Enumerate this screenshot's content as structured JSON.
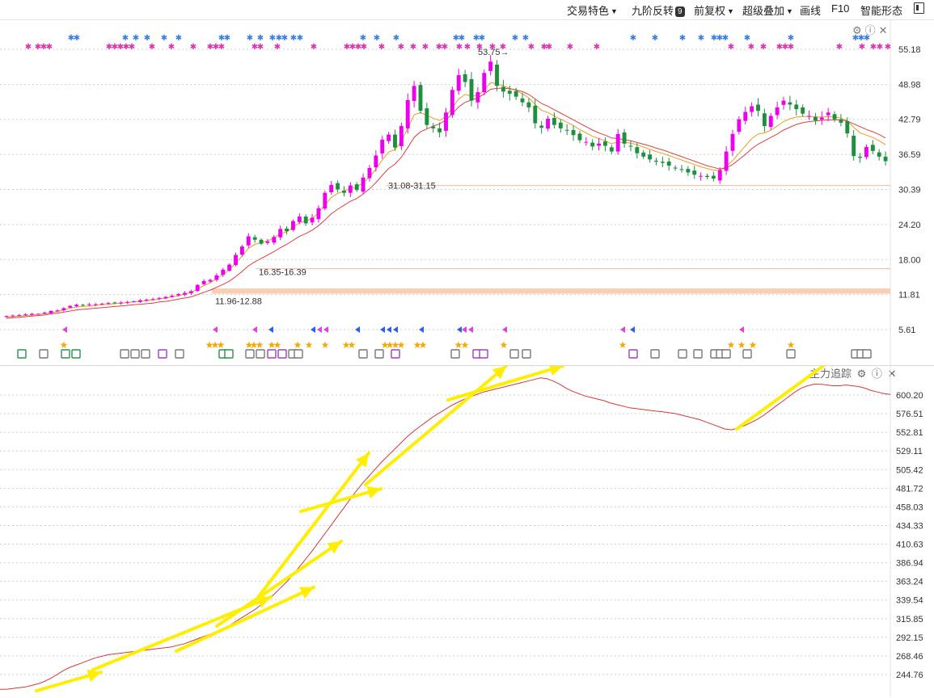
{
  "toolbar": {
    "trade_feature": "交易特色",
    "nine_reversal": "九阶反转",
    "nine_badge": "9",
    "adjust": "前复权",
    "overlay": "超级叠加",
    "draw": "画线",
    "f10": "F10",
    "smart_pattern": "智能形态"
  },
  "sub_panel": {
    "title": "主力追踪"
  },
  "colors": {
    "up": "#ee00ee",
    "down": "#1e8f3e",
    "ma1": "#e8a020",
    "ma2": "#e04040",
    "zone": "#f9c9a8",
    "arrow": "#ffee00",
    "track": "#d83838"
  },
  "icons": [
    "settings-icon",
    "help-icon",
    "close-icon",
    "window-icon",
    "caret-down-icon"
  ],
  "chart_data": [
    {
      "type": "candlestick",
      "y_axis": {
        "ticks": [
          "55.18",
          "48.98",
          "42.79",
          "36.59",
          "30.39",
          "24.20",
          "18.00",
          "11.81",
          "5.61"
        ],
        "ylim": [
          2.5,
          58.3
        ]
      },
      "annotations": [
        {
          "text": "53.75",
          "value": 53.75
        },
        {
          "text": "31.08-31.15",
          "value": 31.1
        },
        {
          "text": "16.35-16.39",
          "value": 16.37
        },
        {
          "text": "11.96-12.88",
          "value": 12.4
        }
      ],
      "support_zone": [
        11.96,
        12.88
      ],
      "closes": [
        8.0,
        8.1,
        8.2,
        8.3,
        8.4,
        8.4,
        8.6,
        8.9,
        9.0,
        9.4,
        9.8,
        10.0,
        9.9,
        10.1,
        10.1,
        10.2,
        10.3,
        10.3,
        10.4,
        10.5,
        10.6,
        10.8,
        10.9,
        11.0,
        11.2,
        11.4,
        11.6,
        11.9,
        12.1,
        12.4,
        13.5,
        14.2,
        14.4,
        15.2,
        16.2,
        17.1,
        18.8,
        20.3,
        22.1,
        21.5,
        20.8,
        21.2,
        22.0,
        23.4,
        23.0,
        24.8,
        25.6,
        24.4,
        25.4,
        27.1,
        29.8,
        31.2,
        30.4,
        29.8,
        31.1,
        30.3,
        32.5,
        34.2,
        36.4,
        39.2,
        40.1,
        37.8,
        41.6,
        46.2,
        48.7,
        44.3,
        41.8,
        41.2,
        40.5,
        44.0,
        48.0,
        50.6,
        49.4,
        46.1,
        47.6,
        51.0,
        53.0,
        48.7,
        47.7,
        47.3,
        46.8,
        45.8,
        44.9,
        42.1,
        41.3,
        42.9,
        41.8,
        41.2,
        40.9,
        40.0,
        39.1,
        38.8,
        38.0,
        38.5,
        38.1,
        37.1,
        40.2,
        38.5,
        38.0,
        36.8,
        36.2,
        35.7,
        35.3,
        35.1,
        34.6,
        34.1,
        33.9,
        33.4,
        33.0,
        32.8,
        32.6,
        32.3,
        33.8,
        37.1,
        40.2,
        42.8,
        44.1,
        45.1,
        44.3,
        41.6,
        43.4,
        44.9,
        46.1,
        45.4,
        44.6,
        43.8,
        43.4,
        42.6,
        43.1,
        44.0,
        42.8,
        42.2,
        40.3,
        36.3,
        36.0,
        37.9,
        37.2,
        36.2,
        35.4
      ],
      "series": [
        {
          "name": "",
          "values": [
            7.8,
            7.9,
            8.0,
            8.1,
            8.2,
            8.3,
            8.4,
            8.6,
            8.8,
            9.1,
            9.4,
            9.6,
            9.7,
            9.8,
            9.9,
            10.0,
            10.1,
            10.2,
            10.3,
            10.4,
            10.5,
            10.6,
            10.7,
            10.9,
            11.0,
            11.2,
            11.4,
            11.6,
            11.9,
            12.2,
            12.8,
            13.4,
            13.9,
            14.6,
            15.4,
            16.2,
            17.4,
            18.6,
            20.0,
            20.7,
            21.0,
            21.3,
            21.8,
            22.6,
            22.9,
            23.7,
            24.5,
            24.8,
            25.3,
            26.3,
            27.6,
            29.0,
            29.7,
            30.1,
            30.6,
            30.8,
            31.6,
            32.6,
            34.0,
            35.6,
            37.0,
            37.5,
            38.9,
            41.2,
            43.6,
            44.0,
            43.5,
            43.0,
            42.6,
            43.3,
            44.9,
            46.4,
            47.2,
            46.9,
            47.0,
            48.0,
            49.3,
            49.1,
            48.7,
            48.3,
            47.9,
            47.3,
            46.6,
            45.4,
            44.4,
            44.0,
            43.4,
            42.8,
            42.3,
            41.7,
            41.0,
            40.4,
            39.8,
            39.4,
            39.0,
            38.5,
            38.8,
            38.7,
            38.6,
            38.3,
            37.9,
            37.5,
            37.1,
            36.8,
            36.4,
            36.0,
            35.6,
            35.2,
            34.8,
            34.4,
            34.1,
            33.8,
            33.8,
            34.5,
            35.5,
            36.8,
            38.1,
            39.4,
            40.2,
            40.4,
            40.9,
            41.6,
            42.4,
            42.9,
            43.2,
            43.3,
            43.3,
            43.2,
            43.2,
            43.3,
            43.2,
            43.0,
            42.5,
            41.4,
            40.4,
            40.0,
            39.6,
            39.0,
            38.3
          ]
        },
        {
          "name": "",
          "values": [
            7.6,
            7.7,
            7.8,
            7.9,
            8.0,
            8.1,
            8.2,
            8.4,
            8.5,
            8.7,
            8.9,
            9.1,
            9.2,
            9.3,
            9.4,
            9.5,
            9.6,
            9.7,
            9.8,
            9.9,
            10.0,
            10.1,
            10.2,
            10.3,
            10.5,
            10.6,
            10.8,
            11.0,
            11.2,
            11.4,
            11.8,
            12.2,
            12.6,
            13.1,
            13.6,
            14.2,
            15.0,
            15.9,
            16.9,
            17.6,
            18.2,
            18.8,
            19.4,
            20.1,
            20.7,
            21.4,
            22.1,
            22.6,
            23.2,
            24.0,
            25.0,
            26.1,
            26.9,
            27.6,
            28.3,
            28.8,
            29.6,
            30.5,
            31.6,
            32.9,
            34.1,
            34.9,
            36.1,
            37.8,
            39.6,
            40.6,
            41.1,
            41.6,
            42.0,
            42.7,
            43.8,
            45.0,
            45.8,
            46.2,
            46.6,
            47.3,
            48.1,
            48.3,
            48.3,
            48.2,
            48.0,
            47.7,
            47.2,
            46.4,
            45.6,
            45.1,
            44.5,
            43.9,
            43.3,
            42.7,
            42.1,
            41.5,
            40.9,
            40.4,
            40.0,
            39.5,
            39.4,
            39.2,
            39.0,
            38.7,
            38.4,
            38.1,
            37.7,
            37.4,
            37.0,
            36.6,
            36.2,
            35.8,
            35.4,
            35.0,
            34.6,
            34.3,
            34.0,
            34.2,
            34.8,
            35.7,
            36.6,
            37.6,
            38.4,
            39.0,
            39.6,
            40.2,
            40.9,
            41.4,
            41.9,
            42.2,
            42.4,
            42.5,
            42.6,
            42.7,
            42.7,
            42.7,
            42.5,
            42.0,
            41.5,
            41.0,
            40.6,
            40.1,
            39.5
          ]
        }
      ]
    },
    {
      "type": "line",
      "title": "主力追踪",
      "y_axis": {
        "ticks": [
          "600.20",
          "576.51",
          "552.81",
          "529.11",
          "505.42",
          "481.72",
          "458.03",
          "434.33",
          "410.63",
          "386.94",
          "363.24",
          "339.54",
          "315.85",
          "292.15",
          "268.46",
          "244.76"
        ],
        "ylim": [
          225,
          630
        ]
      },
      "series": [
        {
          "name": "",
          "values": [
            226,
            226,
            227,
            228,
            229,
            231,
            233,
            236,
            240,
            245,
            250,
            254,
            257,
            260,
            263,
            266,
            268,
            270,
            271,
            272,
            273,
            274,
            275,
            276,
            277,
            278,
            279,
            280,
            282,
            284,
            287,
            290,
            293,
            296,
            299,
            303,
            307,
            312,
            317,
            322,
            327,
            333,
            339,
            346,
            354,
            362,
            371,
            381,
            391,
            401,
            412,
            423,
            434,
            445,
            456,
            467,
            478,
            488,
            497,
            506,
            515,
            523,
            531,
            539,
            547,
            554,
            560,
            566,
            572,
            577,
            582,
            587,
            591,
            595,
            598,
            601,
            604,
            606,
            608,
            610,
            612,
            614,
            616,
            618,
            620,
            622,
            621,
            618,
            614,
            609,
            605,
            602,
            599,
            597,
            595,
            593,
            590,
            588,
            586,
            584,
            583,
            582,
            581,
            580,
            579,
            578,
            577,
            575,
            573,
            571,
            569,
            566,
            563,
            560,
            557,
            556,
            558,
            561,
            565,
            569,
            574,
            580,
            586,
            592,
            598,
            604,
            609,
            612,
            614,
            614,
            613,
            612,
            612,
            613,
            612,
            611,
            609,
            606,
            604,
            602,
            601
          ]
        }
      ]
    }
  ]
}
